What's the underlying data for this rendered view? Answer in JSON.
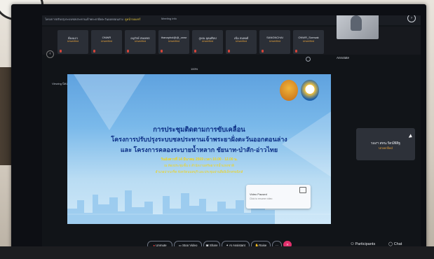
{
  "tabbar": {
    "title": "โครงการปรับปรุงระบบชลประทานเจ้าพระยาฝั่งตะวันออกตอนล่าง",
    "mode": "ดูหน้าจอแชร์",
    "meeting_info": "Meeting info"
  },
  "participants": [
    {
      "name": "ห้องแถว",
      "status": "Unverified"
    },
    {
      "name": "ONWR",
      "status": "Unverified"
    },
    {
      "name": "อนุรักษ์ สหเพชร",
      "status": "Unverified"
    },
    {
      "name": "thanaphol@@_onwr",
      "status": "Unverified"
    },
    {
      "name": "ภูษณ อุดมศิลป",
      "status": "Unverified"
    },
    {
      "name": "เข้ม สมพงศ์",
      "status": "Unverified"
    },
    {
      "name": "SANGNCHAI",
      "status": "Unverified"
    },
    {
      "name": "ONWR_Somsak",
      "status": "Unverified"
    }
  ],
  "viewing": "Viewing นิคมชัย เชษฐ์'s screen",
  "zoom": "100%",
  "annotate": "Annotate",
  "slide": {
    "line1": "การประชุมติดตามการขับเคลื่อน",
    "line2": "โครงการปรับปรุงระบบชลประทานเจ้าพระยาฝั่งตะวันออกตอนล่าง",
    "line3": "และ โครงการคลองระบายน้ำหลาก ชัยนาท-ป่าสัก-อ่าวไทย",
    "line4": "วันอังคารที่ 14 มีนาคม 2569 เวลา 10.00 - 12.00 น.",
    "line5": "ณ ห้องประชุมชั้น 4 สำนักงานทรัพยากรน้ำแห่งชาติ",
    "line6": "อำเภอปากเกร็ด จังหวัดนนทบุรี และประชุมผ่านสื่ออิเล็กทรอนิกส์",
    "popup_label": "Video Paused",
    "popup_hint": "Click to resume video"
  },
  "side_tile": {
    "name": "รองฯ สทน.รัตน์พิสิฐ",
    "status": "Unverified"
  },
  "toolbar": {
    "unmute": "Unmute",
    "stop_video": "Stop Video",
    "share": "Share",
    "ai": "AI Assistant",
    "raise": "Raise",
    "participants": "Participants",
    "chat": "Chat"
  },
  "colors": {
    "accent": "#e1306c",
    "unverified": "#e6a23c"
  }
}
